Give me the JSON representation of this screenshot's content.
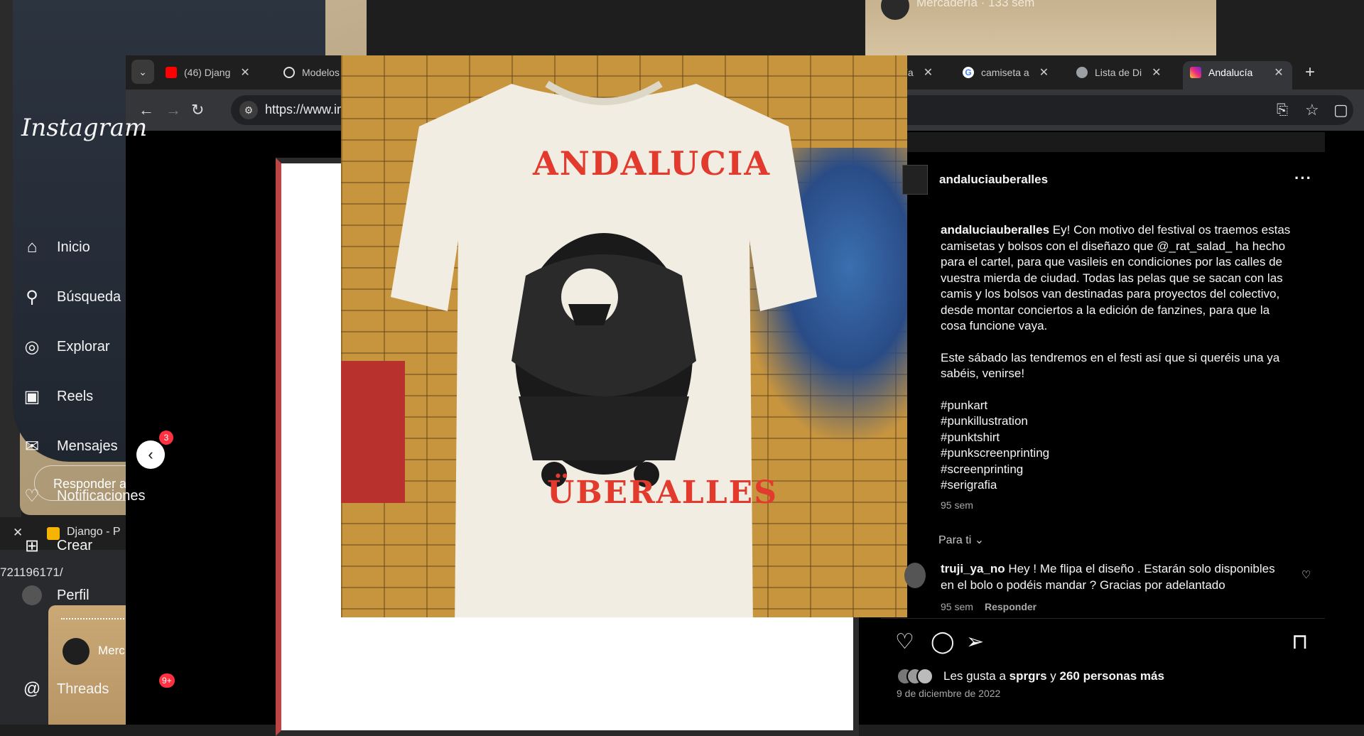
{
  "background": {
    "reply_placeholder": "Responder a",
    "bottom_tab_label": "Django - P",
    "bottom_url": "721196171/",
    "bottom_name": "Merc",
    "top_right_name": "Mercadería · 133 sem"
  },
  "browser": {
    "tabs": [
      {
        "label": "(46) Djang",
        "icon_color": "#ff0000"
      },
      {
        "label": "Modelos",
        "icon_color": "#e0e0e0"
      },
      {
        "label": "camiseta a",
        "icon_color": "#4285f4"
      },
      {
        "label": "Lista de Di",
        "icon_color": "#9aa0a6"
      },
      {
        "label": "Andalucía",
        "icon_color": "#e1306c"
      }
    ],
    "partial_tab_label": "cía",
    "url": "https://www.in",
    "close_glyph": "✕",
    "new_tab_glyph": "+"
  },
  "instagram": {
    "logo": "Instagram",
    "nav": [
      {
        "label": "Inicio",
        "icon": "home-icon"
      },
      {
        "label": "Búsqueda",
        "icon": "search-icon"
      },
      {
        "label": "Explorar",
        "icon": "compass-icon"
      },
      {
        "label": "Reels",
        "icon": "reels-icon"
      },
      {
        "label": "Mensajes",
        "icon": "messenger-icon",
        "badge": "3"
      },
      {
        "label": "Notificaciones",
        "icon": "heart-icon"
      },
      {
        "label": "Crear",
        "icon": "plus-square-icon"
      },
      {
        "label": "Perfil",
        "icon": "avatar"
      },
      {
        "label": "Threads",
        "icon": "threads-icon",
        "badge": "9+"
      }
    ],
    "post": {
      "username": "andaluciauberalles",
      "shirt_text_top": "ANDALUCIA",
      "shirt_text_bottom": "ÜBERALLES",
      "caption_user": "andaluciauberalles",
      "caption_1": " Ey! Con motivo del festival os traemos estas camisetas y bolsos con el diseñazo que @_rat_salad_ ha hecho para el cartel, para que vasileis en condiciones por las calles de vuestra mierda de ciudad. Todas las pelas que se sacan con las camis y los bolsos van destinadas para proyectos del colectivo, desde montar conciertos a la edición de fanzines, para que la cosa funcione vaya.",
      "caption_2": "Este sábado las tendremos en el festi así que si queréis una ya sabéis, venirse!",
      "hashtags": [
        "#punkart",
        "#punkillustration",
        "#punktshirt",
        "#punkscreenprinting",
        "#screenprinting",
        "#serigrafia"
      ],
      "caption_time": "95 sem",
      "para_ti": "Para ti",
      "comment": {
        "user": "truji_ya_no",
        "text": " Hey ! Me flipa el diseño . Estarán solo disponibles en el bolo o podéis mandar ? Gracias por adelantado",
        "time": "95 sem",
        "reply": "Responder"
      },
      "likes_prefix": "Les gusta a ",
      "likes_user": "sprgrs",
      "likes_mid": " y ",
      "likes_count": "260 personas más",
      "date": "9 de diciembre de 2022"
    }
  }
}
